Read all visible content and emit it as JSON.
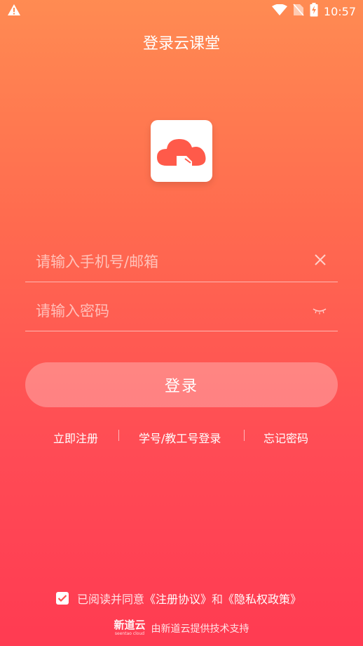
{
  "status_bar": {
    "time": "10:57",
    "icons": [
      "warning-icon",
      "wifi-icon",
      "no-sim-icon",
      "battery-charging-icon"
    ]
  },
  "header": {
    "title": "登录云课堂"
  },
  "app_logo": {
    "icon": "cloud-logo-icon",
    "accent": "#ff5a4a"
  },
  "form": {
    "account_placeholder": "请输入手机号/邮箱",
    "password_placeholder": "请输入密码",
    "clear_icon": "close-icon",
    "visibility_icon": "eye-closed-icon"
  },
  "login_button": {
    "label": "登录"
  },
  "links": {
    "register": "立即注册",
    "student_login": "学号/教工号登录",
    "forgot": "忘记密码"
  },
  "agreement": {
    "prefix": "已阅读并同意",
    "terms": "《注册协议》",
    "and": "和",
    "privacy": "《隐私权政策》",
    "checked": true
  },
  "footer": {
    "brand_cn": "新道云",
    "brand_en": "seentao cloud",
    "text": "由新道云提供技术支持"
  },
  "colors": {
    "gradient_top": "#ff8b52",
    "gradient_bottom": "#ff3b52"
  }
}
